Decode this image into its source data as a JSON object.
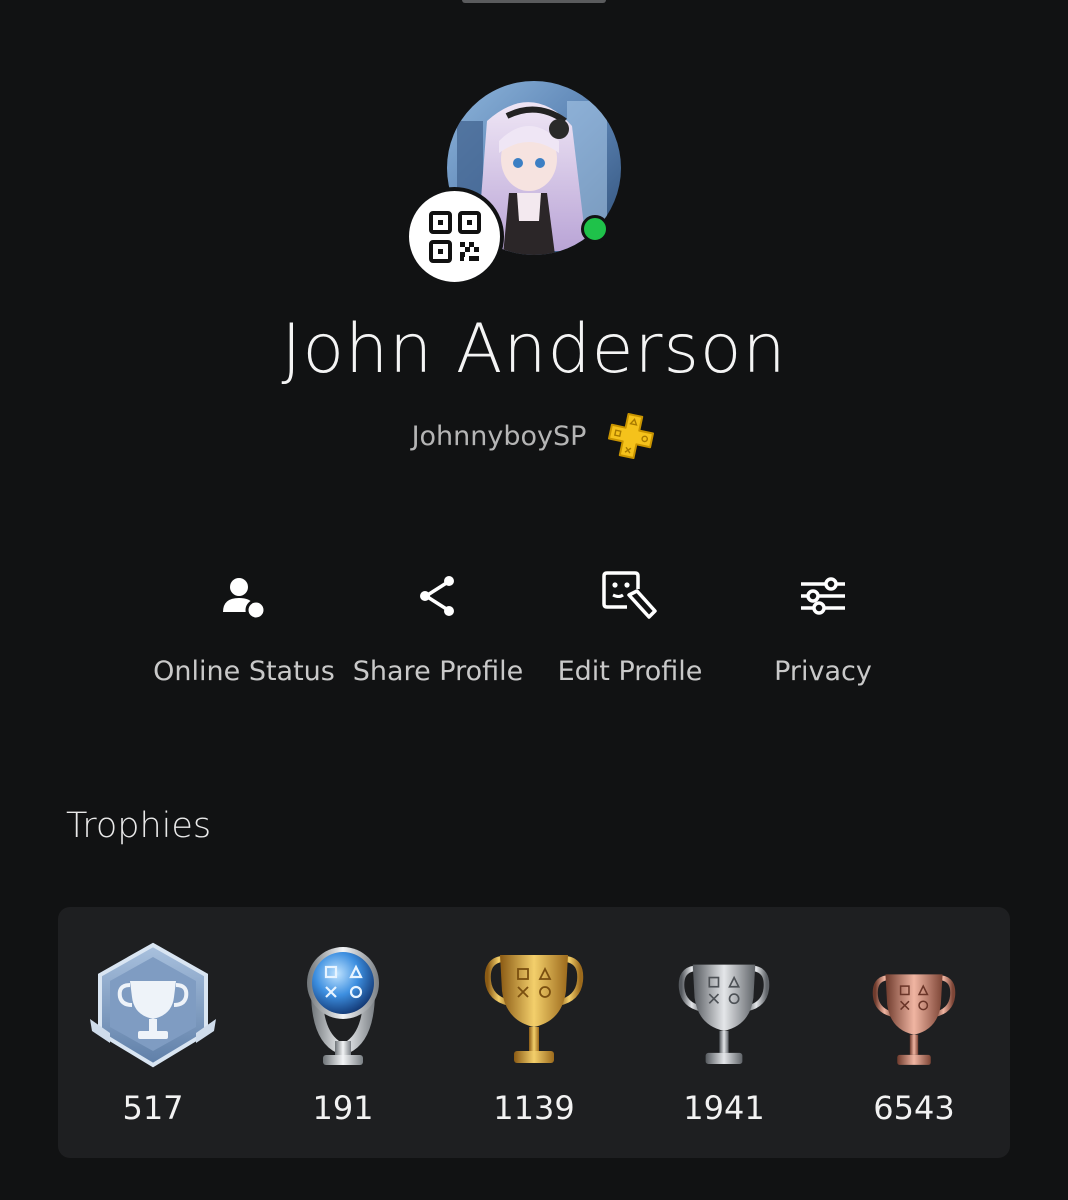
{
  "profile": {
    "display_name": "John Anderson",
    "online_id": "JohnnyboySP",
    "online_status": "online",
    "subscription_badge": "playstation-plus-icon"
  },
  "actions": [
    {
      "label": "Online Status",
      "icon": "online-status-icon"
    },
    {
      "label": "Share Profile",
      "icon": "share-icon"
    },
    {
      "label": "Edit Profile",
      "icon": "edit-profile-icon"
    },
    {
      "label": "Privacy",
      "icon": "privacy-sliders-icon"
    }
  ],
  "trophies": {
    "heading": "Trophies",
    "items": [
      {
        "type": "level",
        "icon": "trophy-level-icon",
        "count": "517"
      },
      {
        "type": "platinum",
        "icon": "platinum-trophy-icon",
        "count": "191"
      },
      {
        "type": "gold",
        "icon": "gold-trophy-icon",
        "count": "1139"
      },
      {
        "type": "silver",
        "icon": "silver-trophy-icon",
        "count": "1941"
      },
      {
        "type": "bronze",
        "icon": "bronze-trophy-icon",
        "count": "6543"
      }
    ]
  },
  "colors": {
    "background": "#111213",
    "card": "#1e1f21",
    "online": "#1fc24a",
    "plus": "#f5c21b",
    "gold": "#d9a437",
    "silver": "#b9bcc0",
    "bronze": "#c98070",
    "platinum": "#3d8fe0"
  }
}
